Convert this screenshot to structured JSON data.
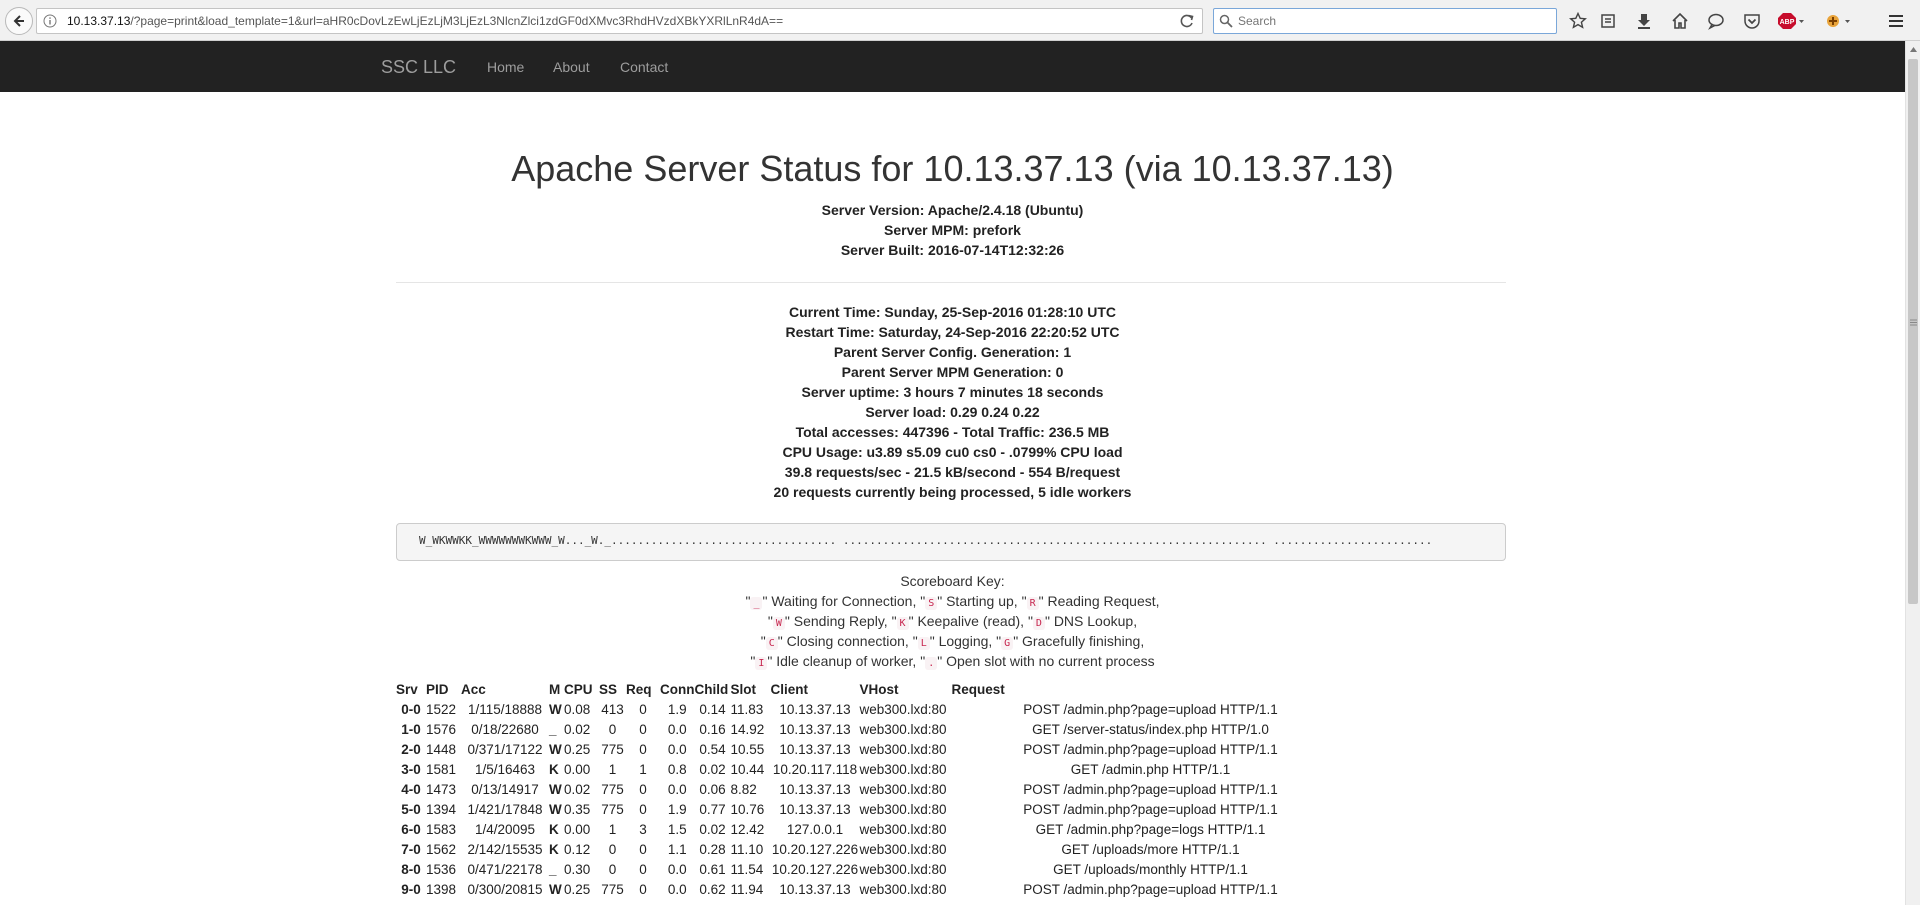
{
  "browser": {
    "url_host": "10.13.37.13",
    "url_rest": "/?page=print&load_template=1&url=aHR0cDovLzEwLjEzLjM3LjEzL3NlcnZlci1zdGF0dXMvc3RhdHVzdXBkYXRlLnR4dA==",
    "search_placeholder": "Search",
    "colors": {
      "chrome": "#f1f1f1",
      "abp": "#c70d2c"
    },
    "icons": [
      "back-arrow-icon",
      "info-icon",
      "reload-icon",
      "search-icon",
      "star-icon",
      "reading-list-icon",
      "download-icon",
      "home-icon",
      "chat-icon",
      "pocket-icon",
      "adblock-plus-icon",
      "extension-icon",
      "menu-icon"
    ]
  },
  "navbar": {
    "brand": "SSC LLC",
    "links": [
      "Home",
      "About",
      "Contact"
    ],
    "bg_color": "#222222"
  },
  "page": {
    "title": "Apache Server Status for 10.13.37.13 (via 10.13.37.13)",
    "server_info": [
      "Server Version: Apache/2.4.18 (Ubuntu)",
      "Server MPM: prefork",
      "Server Built: 2016-07-14T12:32:26"
    ],
    "stats": [
      "Current Time: Sunday, 25-Sep-2016 01:28:10 UTC",
      "Restart Time: Saturday, 24-Sep-2016 22:20:52 UTC",
      "Parent Server Config. Generation: 1",
      "Parent Server MPM Generation: 0",
      "Server uptime: 3 hours 7 minutes 18 seconds",
      "Server load: 0.29 0.24 0.22",
      "Total accesses: 447396 - Total Traffic: 236.5 MB",
      "CPU Usage: u3.89 s5.09 cu0 cs0 - .0799% CPU load",
      "39.8 requests/sec - 21.5 kB/second - 554 B/request",
      "20 requests currently being processed, 5 idle workers"
    ],
    "scoreboard": "W_WKWWKK_WWWWWWWKWWW_W..._W._.................................. ................................................................ ........................",
    "key_title": "Scoreboard Key:",
    "key_lines": [
      [
        [
          "_",
          "Waiting for Connection,"
        ],
        [
          "S",
          "Starting up,"
        ],
        [
          "R",
          "Reading Request,"
        ]
      ],
      [
        [
          "W",
          "Sending Reply,"
        ],
        [
          "K",
          "Keepalive (read),"
        ],
        [
          "D",
          "DNS Lookup,"
        ]
      ],
      [
        [
          "C",
          "Closing connection,"
        ],
        [
          "L",
          "Logging,"
        ],
        [
          "G",
          "Gracefully finishing,"
        ]
      ],
      [
        [
          "I",
          "Idle cleanup of worker,"
        ],
        [
          ".",
          "Open slot with no current process"
        ]
      ]
    ]
  },
  "table": {
    "headers": [
      "Srv",
      "PID",
      "Acc",
      "M",
      "CPU",
      "SS",
      "Req",
      "Conn",
      "Child",
      "Slot",
      "Client",
      "VHost",
      "Request"
    ],
    "rows": [
      [
        "0-0",
        "1522",
        "1/115/18888",
        "W",
        "0.08",
        "413",
        "0",
        "1.9",
        "0.14",
        "11.83",
        "10.13.37.13",
        "web300.lxd:80",
        "POST /admin.php?page=upload HTTP/1.1"
      ],
      [
        "1-0",
        "1576",
        "0/18/22680",
        "_",
        "0.02",
        "0",
        "0",
        "0.0",
        "0.16",
        "14.92",
        "10.13.37.13",
        "web300.lxd:80",
        "GET /server-status/index.php HTTP/1.0"
      ],
      [
        "2-0",
        "1448",
        "0/371/17122",
        "W",
        "0.25",
        "775",
        "0",
        "0.0",
        "0.54",
        "10.55",
        "10.13.37.13",
        "web300.lxd:80",
        "POST /admin.php?page=upload HTTP/1.1"
      ],
      [
        "3-0",
        "1581",
        "1/5/16463",
        "K",
        "0.00",
        "1",
        "1",
        "0.8",
        "0.02",
        "10.44",
        "10.20.117.118",
        "web300.lxd:80",
        "GET /admin.php HTTP/1.1"
      ],
      [
        "4-0",
        "1473",
        "0/13/14917",
        "W",
        "0.02",
        "775",
        "0",
        "0.0",
        "0.06",
        "8.82",
        "10.13.37.13",
        "web300.lxd:80",
        "POST /admin.php?page=upload HTTP/1.1"
      ],
      [
        "5-0",
        "1394",
        "1/421/17848",
        "W",
        "0.35",
        "775",
        "0",
        "1.9",
        "0.77",
        "10.76",
        "10.13.37.13",
        "web300.lxd:80",
        "POST /admin.php?page=upload HTTP/1.1"
      ],
      [
        "6-0",
        "1583",
        "1/4/20095",
        "K",
        "0.00",
        "1",
        "3",
        "1.5",
        "0.02",
        "12.42",
        "127.0.0.1",
        "web300.lxd:80",
        "GET /admin.php?page=logs HTTP/1.1"
      ],
      [
        "7-0",
        "1562",
        "2/142/15535",
        "K",
        "0.12",
        "0",
        "0",
        "1.1",
        "0.28",
        "11.10",
        "10.20.127.226",
        "web300.lxd:80",
        "GET /uploads/more HTTP/1.1"
      ],
      [
        "8-0",
        "1536",
        "0/471/22178",
        "_",
        "0.30",
        "0",
        "0",
        "0.0",
        "0.61",
        "11.54",
        "10.20.127.226",
        "web300.lxd:80",
        "GET /uploads/monthly HTTP/1.1"
      ],
      [
        "9-0",
        "1398",
        "0/300/20815",
        "W",
        "0.25",
        "775",
        "0",
        "0.0",
        "0.62",
        "11.94",
        "10.13.37.13",
        "web300.lxd:80",
        "POST /admin.php?page=upload HTTP/1.1"
      ]
    ]
  }
}
